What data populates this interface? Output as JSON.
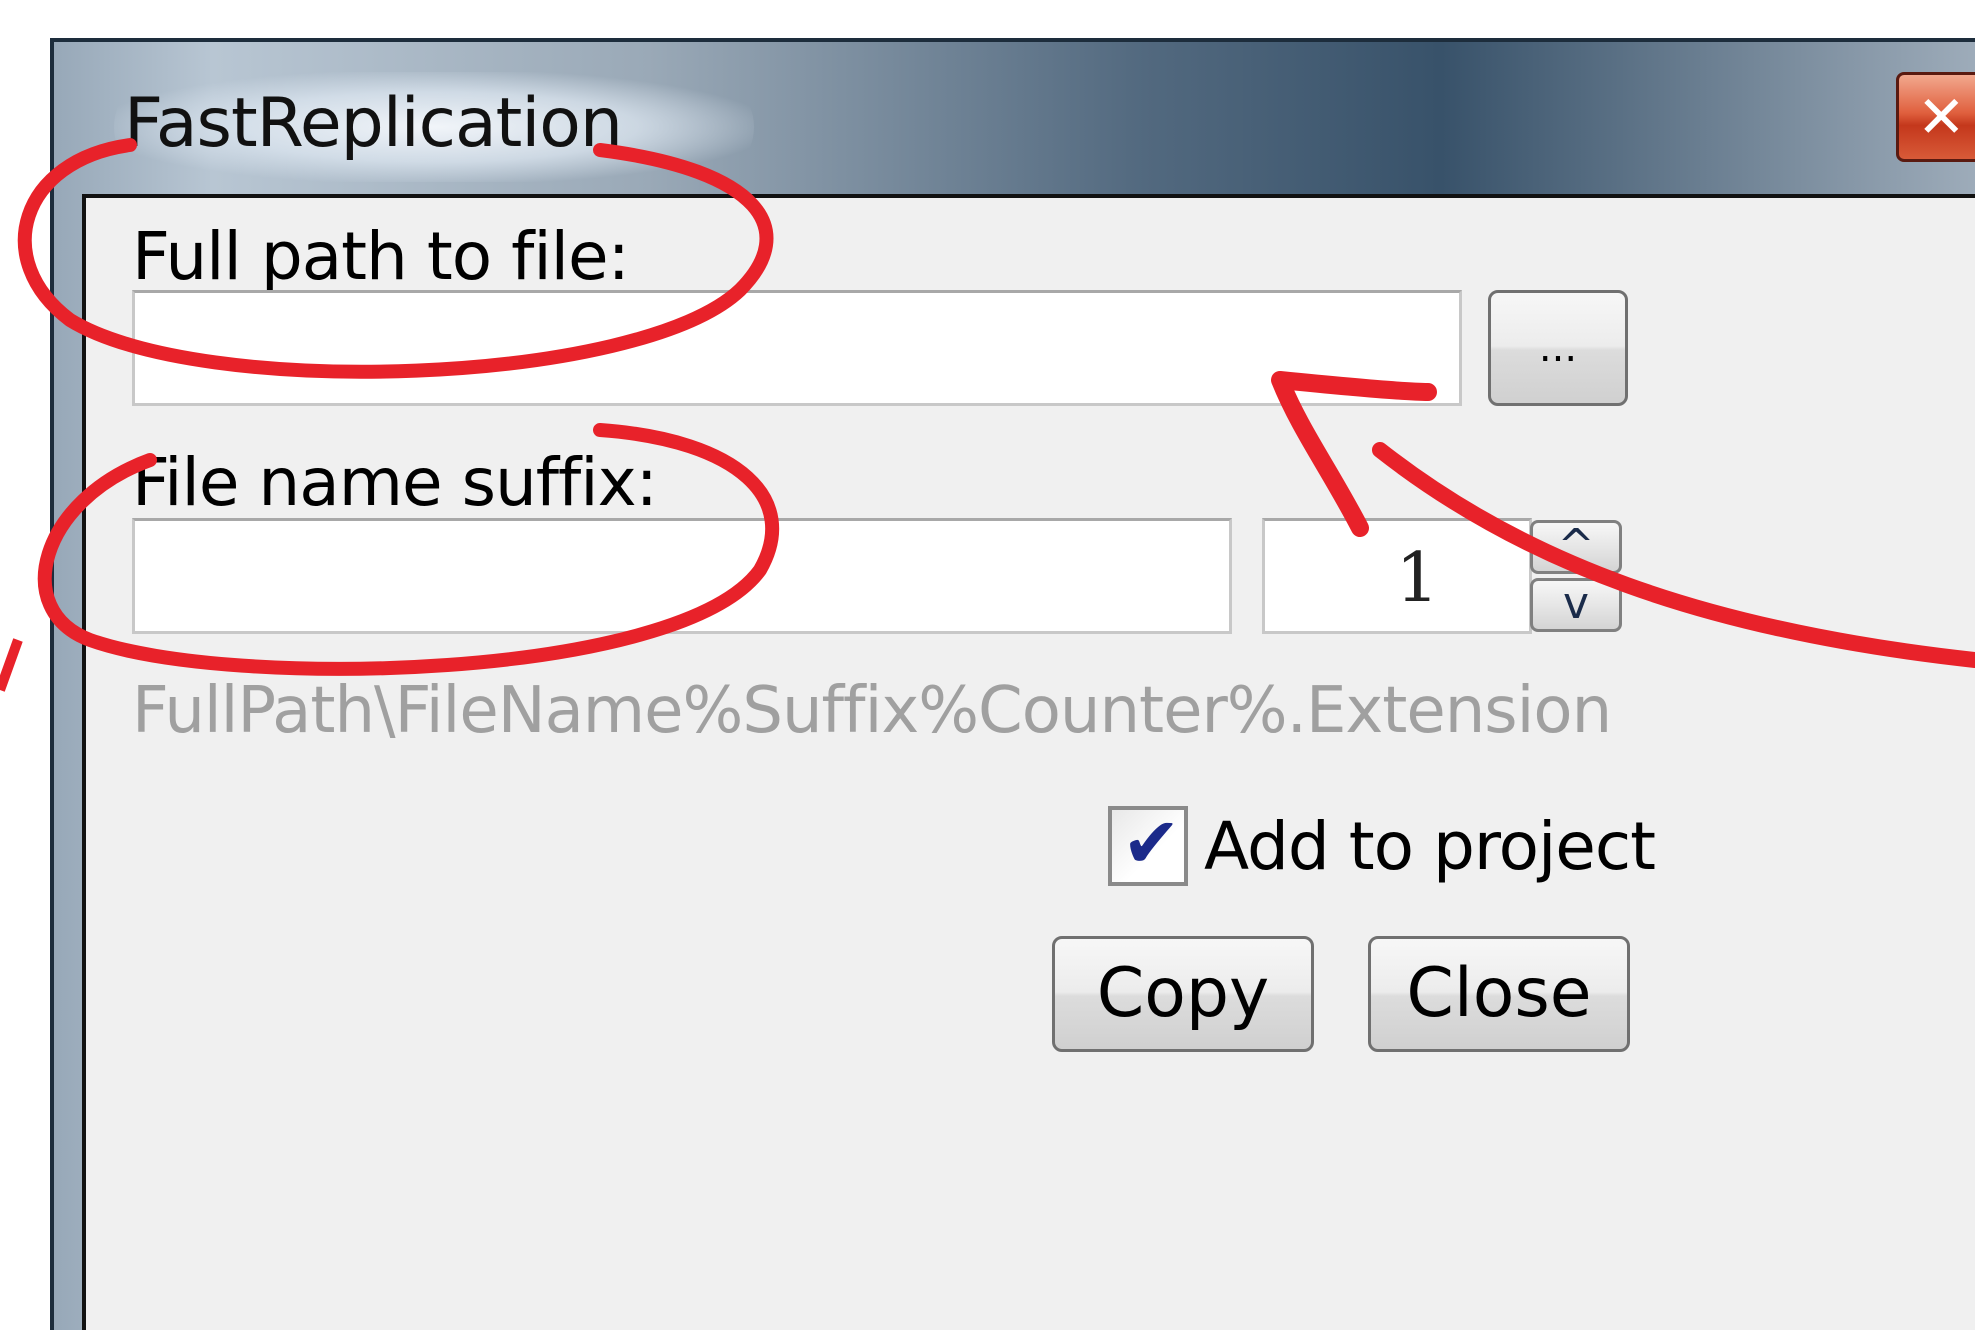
{
  "window": {
    "title": "FastReplication",
    "close_glyph": "✕"
  },
  "form": {
    "path_label": "Full path to file:",
    "path_value": "",
    "browse_label": "...",
    "suffix_label": "File name suffix:",
    "suffix_value": "",
    "counter_value": "1",
    "counter_up": "^",
    "counter_down": "v",
    "pattern_hint": "FullPath\\FileName%Suffix%Counter%.Extension",
    "add_to_project_label": "Add to project",
    "add_to_project_checked": true
  },
  "buttons": {
    "copy_label": "Copy",
    "close_label": "Close"
  },
  "annotation_color": "#e8222a",
  "accent_colors": {
    "close_button": "#d9502e",
    "checkmark": "#1b2a8a",
    "hint_text": "#a0a0a0"
  }
}
